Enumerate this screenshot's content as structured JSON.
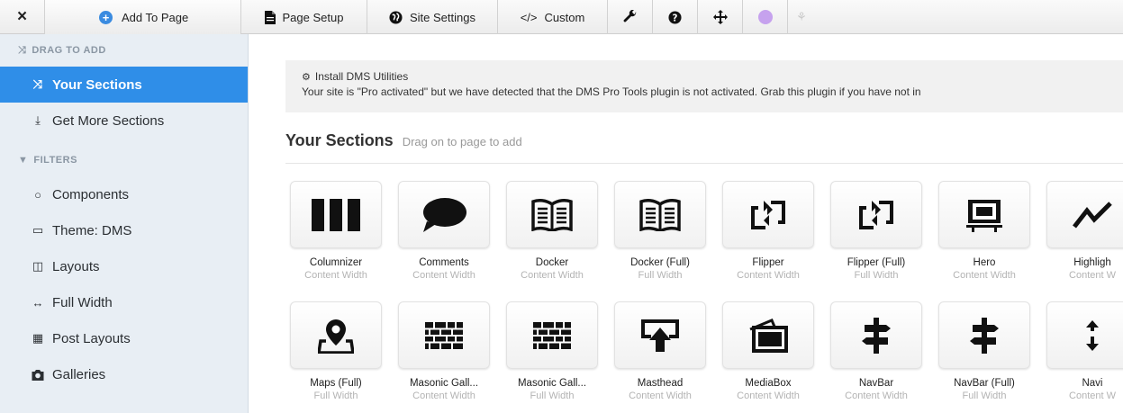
{
  "toolbar": {
    "close_icon": "×",
    "add_label": "Add To Page",
    "page_setup_label": "Page Setup",
    "site_settings_label": "Site Settings",
    "custom_label": "Custom",
    "custom_icon": "</>",
    "wrench_icon": "wrench",
    "help_icon": "question-circle",
    "move_icon": "arrows",
    "accent_dot_color": "#c6a2ee"
  },
  "sidebar": {
    "drag_heading": "DRAG TO ADD",
    "your_sections": "Your Sections",
    "get_more": "Get More Sections",
    "filters_heading": "FILTERS",
    "filters": [
      {
        "label": "Components",
        "icon": "○"
      },
      {
        "label": "Theme: DMS",
        "icon": "▭"
      },
      {
        "label": "Layouts",
        "icon": "◫"
      },
      {
        "label": "Full Width",
        "icon": "↔"
      },
      {
        "label": "Post Layouts",
        "icon": "▦"
      },
      {
        "label": "Galleries",
        "icon": "camera"
      }
    ],
    "active_color": "#2f8ee8"
  },
  "notice": {
    "title": "Install DMS Utilities",
    "body": "Your site is \"Pro activated\" but we have detected that the DMS Pro Tools plugin is not activated. Grab this plugin if you have not in"
  },
  "sections": {
    "title": "Your Sections",
    "subtitle": "Drag on to page to add"
  },
  "tiles": [
    {
      "name": "Columnizer",
      "width": "Content Width",
      "icon": "columns-icon"
    },
    {
      "name": "Comments",
      "width": "Content Width",
      "icon": "comment-icon"
    },
    {
      "name": "Docker",
      "width": "Content Width",
      "icon": "book-icon"
    },
    {
      "name": "Docker (Full)",
      "width": "Full Width",
      "icon": "book-icon"
    },
    {
      "name": "Flipper",
      "width": "Content Width",
      "icon": "flip-icon"
    },
    {
      "name": "Flipper (Full)",
      "width": "Full Width",
      "icon": "flip-icon"
    },
    {
      "name": "Hero",
      "width": "Content Width",
      "icon": "monitor-icon"
    },
    {
      "name": "Highligh",
      "width": "Content W",
      "icon": "highlight-icon"
    },
    {
      "name": "Maps (Full)",
      "width": "Full Width",
      "icon": "map-pin-icon"
    },
    {
      "name": "Masonic Gall...",
      "width": "Content Width",
      "icon": "brick-icon"
    },
    {
      "name": "Masonic Gall...",
      "width": "Full Width",
      "icon": "brick-icon"
    },
    {
      "name": "Masthead",
      "width": "Content Width",
      "icon": "masthead-icon"
    },
    {
      "name": "MediaBox",
      "width": "Content Width",
      "icon": "mediabox-icon"
    },
    {
      "name": "NavBar",
      "width": "Content Width",
      "icon": "signpost-icon"
    },
    {
      "name": "NavBar (Full)",
      "width": "Full Width",
      "icon": "signpost-icon"
    },
    {
      "name": "Navi",
      "width": "Content W",
      "icon": "updown-icon"
    }
  ]
}
